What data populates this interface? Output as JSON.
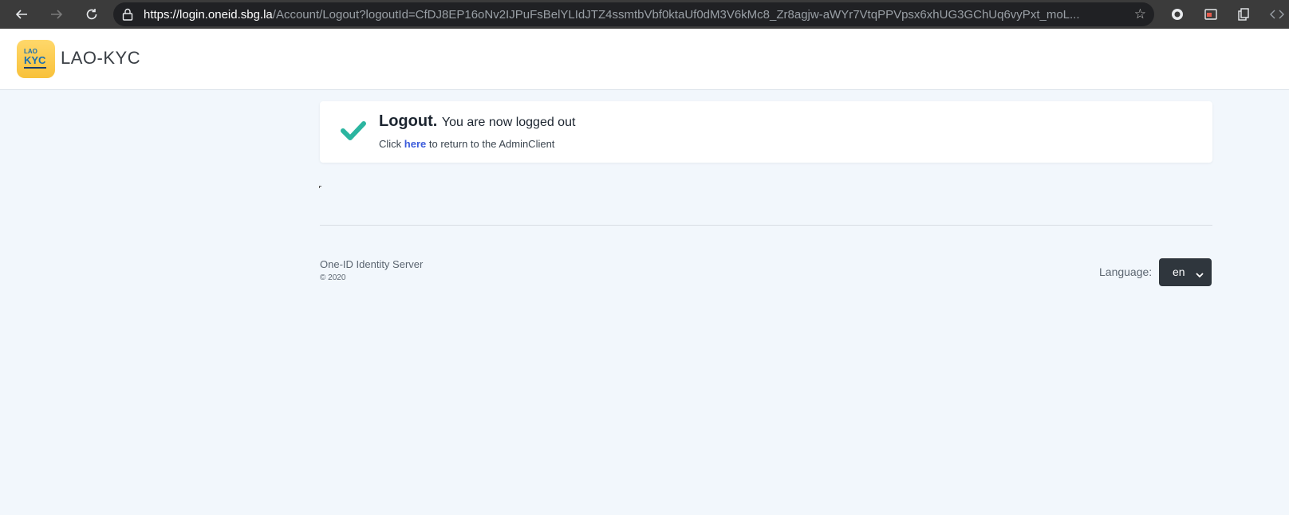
{
  "browser": {
    "url_host": "https://login.oneid.sbg.la",
    "url_rest": "/Account/Logout?logoutId=CfDJ8EP16oNv2IJPuFsBelYLIdJTZ4ssmtbVbf0ktaUf0dM3V6kMc8_Zr8agjw-aWYr7VtqPPVpsx6xhUG3GChUq6vyPxt_moL...",
    "icons": [
      "back-arrow-icon",
      "forward-arrow-icon",
      "reload-icon",
      "lock-icon",
      "star-icon",
      "extension-icon",
      "collections-icon",
      "copy-icon",
      "devtools-icon"
    ]
  },
  "header": {
    "logo_small": "LAO",
    "logo_main": "KYC",
    "brand_name": "LAO-KYC"
  },
  "logout": {
    "title": "Logout.",
    "message": "You are now logged out",
    "click_prefix": "Click",
    "link_text": "here",
    "click_suffix": "to return to the AdminClient",
    "icon": "check-icon",
    "accent_color": "#2bb5a0"
  },
  "footer": {
    "server_name": "One-ID Identity Server",
    "copyright": "© 2020",
    "language_label": "Language:",
    "language_value": "en"
  }
}
